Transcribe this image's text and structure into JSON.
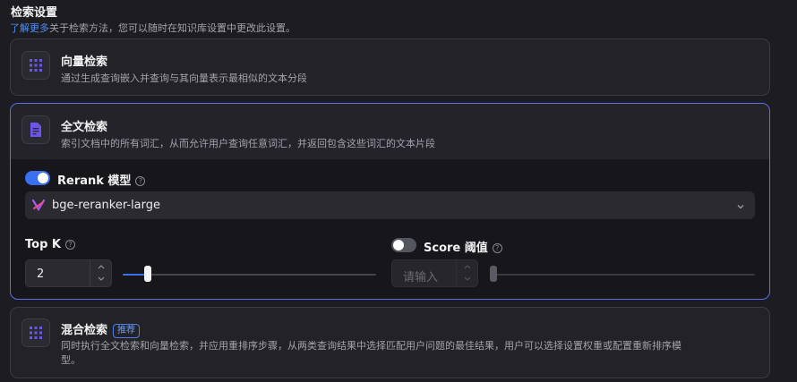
{
  "header": {
    "title": "检索设置",
    "link": "了解更多",
    "desc": "关于检索方法，您可以随时在知识库设置中更改此设置。"
  },
  "methods": [
    {
      "title": "向量检索",
      "desc": "通过生成查询嵌入并查询与其向量表示最相似的文本分段",
      "icon": "grid-icon"
    },
    {
      "title": "全文检索",
      "desc": "索引文档中的所有词汇，从而允许用户查询任意词汇，并返回包含这些词汇的文本片段",
      "icon": "document-icon"
    },
    {
      "title": "混合检索",
      "badge": "推荐",
      "desc_line1": "同时执行全文检索和向量检索，并应用重排序步骤，从两类查询结果中选择匹配用户问题的最佳结果，用户可以选择设置权重或配置重新排序模",
      "desc_line2": "型。",
      "icon": "grid-icon"
    }
  ],
  "rerank": {
    "label": "Rerank 模型",
    "enabled": true,
    "model": "bge-reranker-large"
  },
  "topk": {
    "label": "Top K",
    "value": "2",
    "slider_fraction": 0.1
  },
  "score": {
    "label": "Score 阈值",
    "enabled": false,
    "placeholder": "请输入",
    "slider_fraction": 0.0
  },
  "colors": {
    "accent": "#3a6ff0",
    "selected_border": "#5a6ef0",
    "link": "#4f8ff7"
  }
}
